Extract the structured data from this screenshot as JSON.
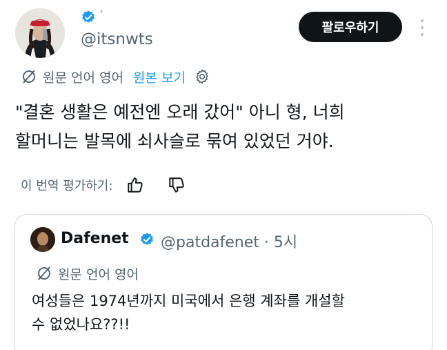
{
  "author": {
    "handle": "@itsnwts",
    "mark": "ᐟ",
    "verified_color": "#1d9bf0"
  },
  "actions": {
    "follow_label": "팔로우하기"
  },
  "translation": {
    "source_label": "원문 언어 영어",
    "show_original_label": "원본 보기"
  },
  "tweet": {
    "line1": "\"결혼 생활은 예전엔 오래 갔어\" 아니 형, 너희",
    "line2": "할머니는 발목에 쇠사슬로 묶여 있었던 거야."
  },
  "rating": {
    "label": "이 번역 평가하기:"
  },
  "quote": {
    "name": "Dafenet",
    "handle_time": "@patdafenet · 5시",
    "translation_label": "원문 언어 영어",
    "line1": "여성들은 1974년까지 미국에서 은행 계좌를 개설할",
    "line2": "수 없었나요??!!"
  },
  "colors": {
    "accent": "#1d9bf0",
    "text_secondary": "#536471",
    "button_bg": "#0f1419"
  }
}
